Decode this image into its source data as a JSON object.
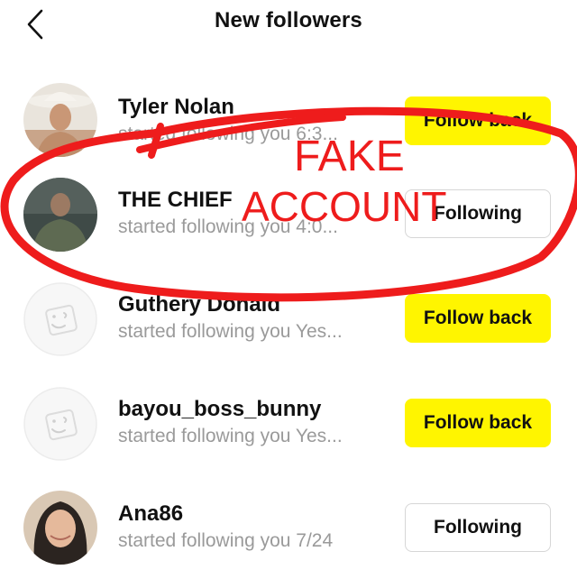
{
  "header": {
    "title": "New followers",
    "back_icon": "chevron-left-icon"
  },
  "followers": [
    {
      "name": "Tyler Nolan",
      "subtitle": "started following you 6:3...",
      "button": "Follow back",
      "button_style": "follow-back"
    },
    {
      "name": "THE CHIEF",
      "subtitle": "started following you 4:0...",
      "button": "Following",
      "button_style": "following"
    },
    {
      "name": "Guthery Donald",
      "subtitle": "started following you Yes...",
      "button": "Follow back",
      "button_style": "follow-back"
    },
    {
      "name": "bayou_boss_bunny",
      "subtitle": "started following you Yes...",
      "button": "Follow back",
      "button_style": "follow-back"
    },
    {
      "name": "Ana86",
      "subtitle": "started following you 7/24",
      "button": "Following",
      "button_style": "following"
    }
  ],
  "annotation": {
    "line1": "FAKE",
    "line2": "ACCOUNT",
    "color": "#EE1C1C"
  },
  "colors": {
    "follow_back_bg": "#FFF500",
    "subtitle_text": "#9a9a9a"
  }
}
